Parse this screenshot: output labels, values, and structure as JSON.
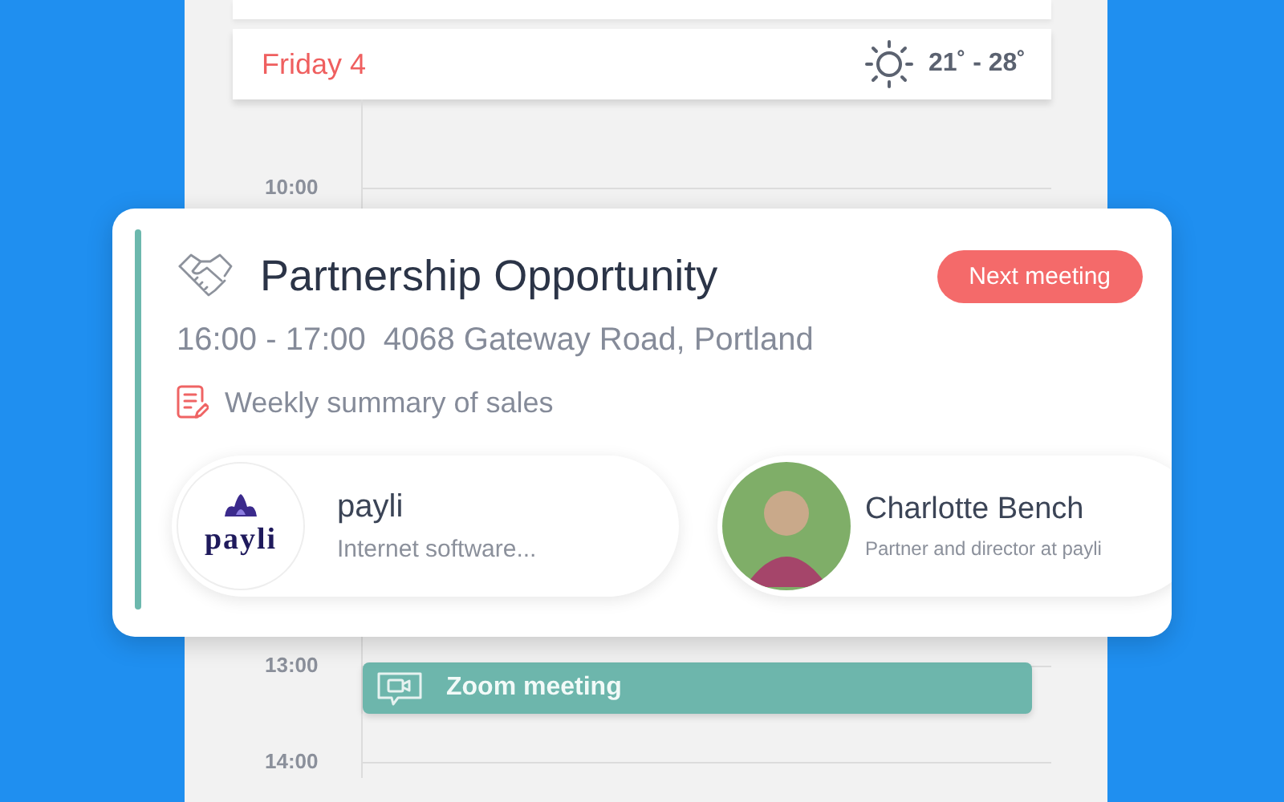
{
  "day": {
    "label": "Friday 4",
    "temperature": "21˚ - 28˚"
  },
  "timeline": [
    {
      "time": "10:00"
    },
    {
      "time": "13:00",
      "event": {
        "title": "Zoom meeting"
      }
    },
    {
      "time": "14:00"
    }
  ],
  "meeting": {
    "title": "Partnership Opportunity",
    "badge": "Next meeting",
    "time": "16:00 - 17:00",
    "location": "4068 Gateway Road, Portland",
    "note": "Weekly summary of sales",
    "company": {
      "logo_text": "payli",
      "name": "payli",
      "description": "Internet software..."
    },
    "contact": {
      "name": "Charlotte Bench",
      "role": "Partner and director at payli"
    }
  }
}
